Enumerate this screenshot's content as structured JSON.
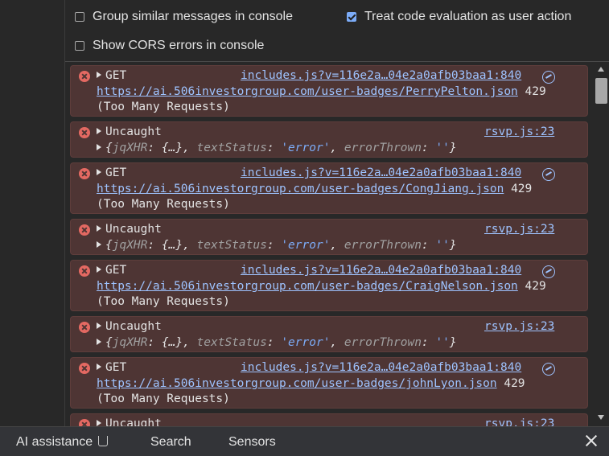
{
  "settings": {
    "group_similar": {
      "label": "Group similar messages in console",
      "checked": false
    },
    "treat_code_eval": {
      "label": "Treat code evaluation as user action",
      "checked": true
    },
    "show_cors": {
      "label": "Show CORS errors in console",
      "checked": false
    }
  },
  "console": {
    "messages": [
      {
        "type": "get",
        "method": "GET",
        "source": "includes.js?v=116e2a…04e2a0afb03baa1:840",
        "url": "https://ai.506investorgroup.com/user-badges/PerryPelton.json",
        "status": "429",
        "status_text": "(Too Many Requests)"
      },
      {
        "type": "uncaught",
        "label": "Uncaught",
        "source": "rsvp.js:23",
        "detail": {
          "k1": "jqXHR",
          "v1": "{…}",
          "k2": "textStatus",
          "v2": "'error'",
          "k3": "errorThrown",
          "v3": "''"
        }
      },
      {
        "type": "get",
        "method": "GET",
        "source": "includes.js?v=116e2a…04e2a0afb03baa1:840",
        "url": "https://ai.506investorgroup.com/user-badges/CongJiang.json",
        "status": "429",
        "status_text": "(Too Many Requests)"
      },
      {
        "type": "uncaught",
        "label": "Uncaught",
        "source": "rsvp.js:23",
        "detail": {
          "k1": "jqXHR",
          "v1": "{…}",
          "k2": "textStatus",
          "v2": "'error'",
          "k3": "errorThrown",
          "v3": "''"
        }
      },
      {
        "type": "get",
        "method": "GET",
        "source": "includes.js?v=116e2a…04e2a0afb03baa1:840",
        "url": "https://ai.506investorgroup.com/user-badges/CraigNelson.json",
        "status": "429",
        "status_text": "(Too Many Requests)"
      },
      {
        "type": "uncaught",
        "label": "Uncaught",
        "source": "rsvp.js:23",
        "detail": {
          "k1": "jqXHR",
          "v1": "{…}",
          "k2": "textStatus",
          "v2": "'error'",
          "k3": "errorThrown",
          "v3": "''"
        }
      },
      {
        "type": "get",
        "method": "GET",
        "source": "includes.js?v=116e2a…04e2a0afb03baa1:840",
        "url": "https://ai.506investorgroup.com/user-badges/johnLyon.json",
        "status": "429",
        "status_text": "(Too Many Requests)"
      },
      {
        "type": "uncaught",
        "label": "Uncaught",
        "source": "rsvp.js:23"
      }
    ]
  },
  "drawer": {
    "tabs": [
      {
        "label": "AI assistance",
        "icon": "flask-icon"
      },
      {
        "label": "Search"
      },
      {
        "label": "Sensors"
      }
    ],
    "close_icon": "close-icon"
  },
  "colors": {
    "error_bg": "#4e3534",
    "error_icon": "#e46962",
    "link": "#9ec3ff",
    "checkbox_accent": "#7cacf8"
  }
}
